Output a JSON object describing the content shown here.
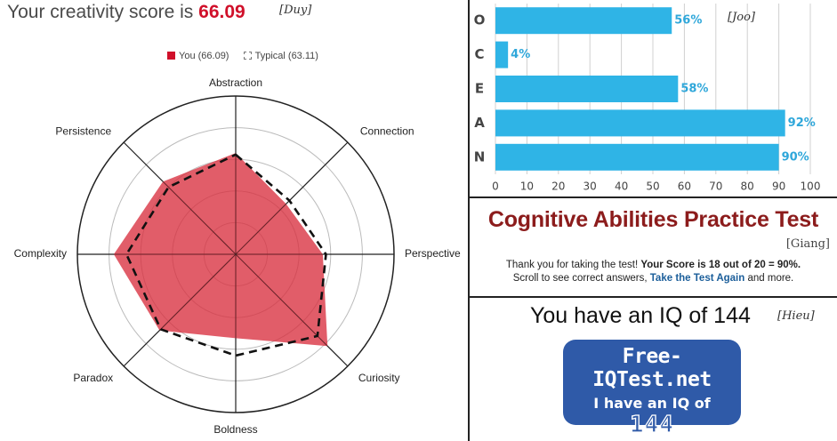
{
  "creativity": {
    "title_prefix": "Your creativity score is ",
    "score": "66.09",
    "tag": "[Duy]",
    "legend_you": "You (66.09)",
    "legend_typical": "Typical (63.11)",
    "colors": {
      "you_fill": "#d9303f",
      "typical_stroke": "#111111",
      "grid": "#333333"
    }
  },
  "ocean": {
    "tag": "[Joo]",
    "bar_color": "#2fb4e6",
    "label_color": "#2fa7da"
  },
  "cognitive": {
    "title": "Cognitive Abilities Practice Test",
    "tag": "[Giang]",
    "line1_normal": "Thank you for taking the test! ",
    "line1_bold": "Your Score is 18 out of 20 = 90%.",
    "line2_start": "Scroll to see correct answers, ",
    "line2_link": "Take the Test Again",
    "line2_end": " and more."
  },
  "iq": {
    "headline": "You have an IQ of 144",
    "tag": "[Hieu]",
    "badge_site": "Free-IQTest.net",
    "badge_line": "I have an IQ of",
    "badge_value": "144"
  },
  "chart_data": [
    {
      "type": "radar",
      "axes": [
        "Abstraction",
        "Connection",
        "Perspective",
        "Curiosity",
        "Boldness",
        "Paradox",
        "Complexity",
        "Persistence"
      ],
      "series": [
        {
          "name": "You (66.09)",
          "values": [
            64,
            45,
            55,
            82,
            53,
            68,
            77,
            65
          ]
        },
        {
          "name": "Typical (63.11)",
          "values": [
            63,
            48,
            57,
            73,
            64,
            67,
            69,
            60
          ]
        }
      ],
      "rlim": [
        0,
        100
      ],
      "rings": 5,
      "legend": "top"
    },
    {
      "type": "bar",
      "orientation": "horizontal",
      "categories": [
        "O",
        "C",
        "E",
        "A",
        "N"
      ],
      "values": [
        56,
        4,
        58,
        92,
        90
      ],
      "value_labels": [
        "56%",
        "4%",
        "58%",
        "92%",
        "90%"
      ],
      "xlim": [
        0,
        100
      ],
      "xticks": [
        "0",
        "10",
        "20",
        "30",
        "40",
        "50",
        "60",
        "70",
        "80",
        "90",
        "100"
      ],
      "grid": true
    }
  ]
}
